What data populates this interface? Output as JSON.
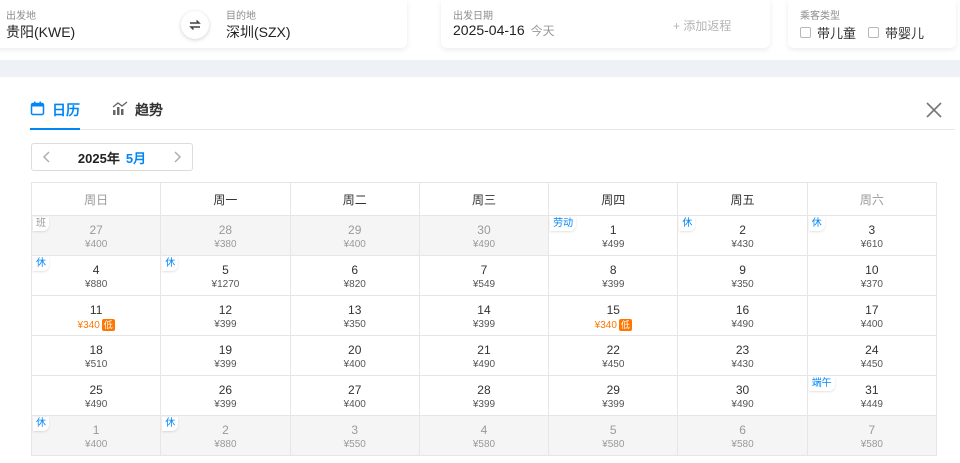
{
  "search": {
    "departure": {
      "label": "出发地",
      "value": "贵阳(KWE)"
    },
    "arrival": {
      "label": "目的地",
      "value": "深圳(SZX)"
    },
    "date": {
      "label": "出发日期",
      "value": "2025-04-16",
      "today": "今天",
      "add_return": "+ 添加返程"
    },
    "passenger": {
      "label": "乘客类型",
      "options": [
        "带儿童",
        "带婴儿"
      ]
    }
  },
  "tabs": [
    {
      "label": "日历",
      "active": true
    },
    {
      "label": "趋势",
      "active": false
    }
  ],
  "month_nav": {
    "year": "2025年",
    "month": "5月"
  },
  "calendar": {
    "weekdays": [
      "周日",
      "周一",
      "周二",
      "周三",
      "周四",
      "周五",
      "周六"
    ],
    "rows": [
      [
        {
          "day": "27",
          "price": "¥400",
          "grey": true,
          "tag": "班"
        },
        {
          "day": "28",
          "price": "¥380",
          "grey": true
        },
        {
          "day": "29",
          "price": "¥400",
          "grey": true
        },
        {
          "day": "30",
          "price": "¥490",
          "grey": true
        },
        {
          "day": "1",
          "price": "¥499",
          "tag": "劳动"
        },
        {
          "day": "2",
          "price": "¥430",
          "tag": "休"
        },
        {
          "day": "3",
          "price": "¥610",
          "tag": "休"
        }
      ],
      [
        {
          "day": "4",
          "price": "¥880",
          "tag": "休"
        },
        {
          "day": "5",
          "price": "¥1270",
          "tag": "休"
        },
        {
          "day": "6",
          "price": "¥820"
        },
        {
          "day": "7",
          "price": "¥549"
        },
        {
          "day": "8",
          "price": "¥399"
        },
        {
          "day": "9",
          "price": "¥350"
        },
        {
          "day": "10",
          "price": "¥370"
        }
      ],
      [
        {
          "day": "11",
          "price": "¥340",
          "low": "低"
        },
        {
          "day": "12",
          "price": "¥399"
        },
        {
          "day": "13",
          "price": "¥350"
        },
        {
          "day": "14",
          "price": "¥399"
        },
        {
          "day": "15",
          "price": "¥340",
          "low": "低"
        },
        {
          "day": "16",
          "price": "¥490"
        },
        {
          "day": "17",
          "price": "¥400"
        }
      ],
      [
        {
          "day": "18",
          "price": "¥510"
        },
        {
          "day": "19",
          "price": "¥399"
        },
        {
          "day": "20",
          "price": "¥400"
        },
        {
          "day": "21",
          "price": "¥490"
        },
        {
          "day": "22",
          "price": "¥450"
        },
        {
          "day": "23",
          "price": "¥430"
        },
        {
          "day": "24",
          "price": "¥450"
        }
      ],
      [
        {
          "day": "25",
          "price": "¥490"
        },
        {
          "day": "26",
          "price": "¥399"
        },
        {
          "day": "27",
          "price": "¥400"
        },
        {
          "day": "28",
          "price": "¥399"
        },
        {
          "day": "29",
          "price": "¥399"
        },
        {
          "day": "30",
          "price": "¥490"
        },
        {
          "day": "31",
          "price": "¥449",
          "tag": "端午"
        }
      ],
      [
        {
          "day": "1",
          "price": "¥400",
          "grey": true,
          "tag": "休"
        },
        {
          "day": "2",
          "price": "¥880",
          "grey": true,
          "tag": "休"
        },
        {
          "day": "3",
          "price": "¥550",
          "grey": true
        },
        {
          "day": "4",
          "price": "¥580",
          "grey": true
        },
        {
          "day": "5",
          "price": "¥580",
          "grey": true
        },
        {
          "day": "6",
          "price": "¥580",
          "grey": true
        },
        {
          "day": "7",
          "price": "¥580",
          "grey": true
        }
      ]
    ]
  },
  "colors": {
    "accent": "#0086f6",
    "low_price": "#ff7700",
    "weekend_header": "#999999"
  }
}
